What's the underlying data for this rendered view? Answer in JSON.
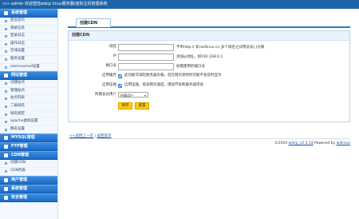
{
  "topbar": {
    "text": "»»» admin 欢迎登陆wdcp linux服务器/虚拟主机管理系统"
  },
  "sidebar": {
    "sections": [
      {
        "title": "系统管理",
        "items": [
          "后台首页",
          "系统信息",
          "登录日志",
          "操作日志",
          "在线设置",
          "服务设置",
          "memcached设置"
        ]
      },
      {
        "title": "网站管理",
        "items": [
          "创建站点",
          "管理站点",
          "站点列表",
          "二级域名",
          "域名绑定",
          "apache虚拟设置",
          "静态设置"
        ]
      },
      {
        "title": "MYSQL管理",
        "items": []
      },
      {
        "title": "FTP管理",
        "items": []
      },
      {
        "title": "CDN管理",
        "items": [
          "创建CDN",
          "CDN列表"
        ]
      },
      {
        "title": "用户管理",
        "items": []
      },
      {
        "title": "系统管理",
        "items": []
      },
      {
        "title": "安全管理",
        "items": []
      }
    ]
  },
  "main": {
    "tab": "创建CDN",
    "panel_title": "创建CDN",
    "form": {
      "domain_label": "域名",
      "domain_hint": "不带http:// 如:wdlinux.cn,多个域名之间用逗号(,)分隔",
      "ip_label": "IP",
      "ip_hint": "添加ip地址，如192.168.0.1",
      "port_label": "端口号",
      "port_hint": "如需使用的端口号",
      "cache_label": "启用缓存",
      "cache_hint": "此功能可减轻服务器负载，但在网页更新时可能不会及时显示",
      "compress_label": "启用压缩",
      "compress_hint": "启用压缩，提高网页速度，增加节省和服务器带宽",
      "owner_label": "所属会员用户",
      "owner_value": "所属用户",
      "save": "保存",
      "reset": "重置"
    },
    "back_links": {
      "back": "<<返回上一页",
      "home": "返回首页"
    },
    "footer": {
      "prefix": "©2010 ",
      "version": "wdcp_v2.5.14",
      "suffix": " Powered by ",
      "brand": "wdlinux"
    }
  },
  "colors": {
    "accent": "#1e63a7",
    "sidebar_head": "#2a7ad4",
    "button": "#ffcc00"
  }
}
